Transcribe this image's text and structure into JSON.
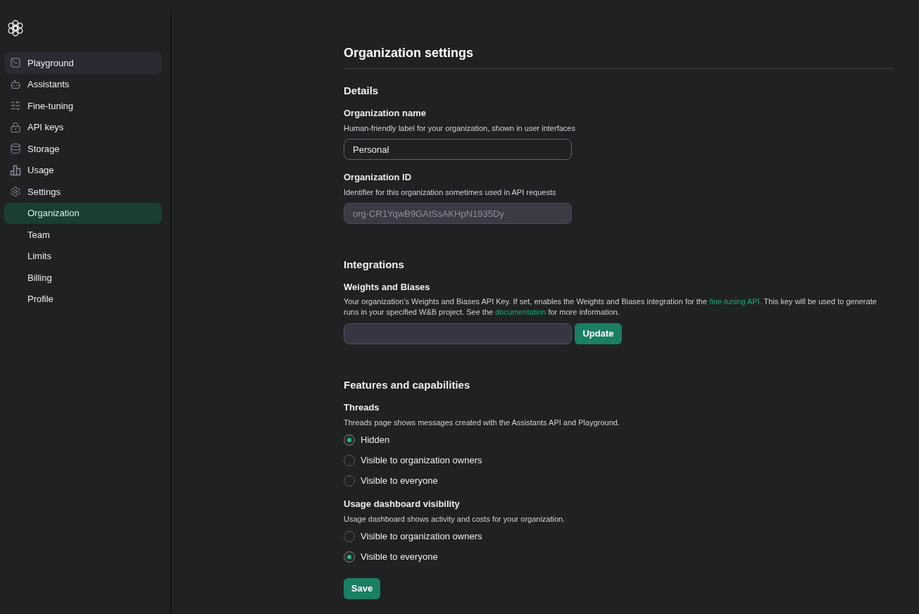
{
  "sidebar": {
    "items": [
      {
        "label": "Playground",
        "selected": false,
        "hovered": true
      },
      {
        "label": "Assistants",
        "selected": false,
        "hovered": false
      },
      {
        "label": "Fine-tuning",
        "selected": false,
        "hovered": false
      },
      {
        "label": "API keys",
        "selected": false,
        "hovered": false
      },
      {
        "label": "Storage",
        "selected": false,
        "hovered": false
      },
      {
        "label": "Usage",
        "selected": false,
        "hovered": false
      },
      {
        "label": "Settings",
        "selected": false,
        "hovered": false,
        "children": [
          {
            "label": "Organization",
            "selected": true,
            "hovered": false
          },
          {
            "label": "Team",
            "selected": false,
            "hovered": false
          },
          {
            "label": "Limits",
            "selected": false,
            "hovered": false
          },
          {
            "label": "Billing",
            "selected": false,
            "hovered": false
          },
          {
            "label": "Profile",
            "selected": false,
            "hovered": false
          }
        ]
      }
    ]
  },
  "page": {
    "title": "Organization settings",
    "sections": [
      {
        "heading": "Details",
        "fields": [
          {
            "kind": "text_input",
            "label": "Organization name",
            "description": "Human-friendly label for your organization, shown in user interfaces",
            "value": "Personal",
            "disabled": false
          },
          {
            "kind": "text_input",
            "label": "Organization ID",
            "description": "Identifier for this organization sometimes used in API requests",
            "value": "org-CR1YqwB9GAtSsAKHpN1935Dy",
            "disabled": true
          }
        ]
      },
      {
        "heading": "Integrations",
        "fields": [
          {
            "kind": "input_with_button",
            "label": "Weights and Biases",
            "description": [
              {
                "text": "Your organization’s Weights and Biases API Key. If set, enables the Weights and Biases integration for the "
              },
              {
                "text": "fine-tuning API.",
                "link": true
              },
              {
                "text": " This key will be used to generate runs in your specified W&B project. See the "
              },
              {
                "text": "documentation",
                "link": true
              },
              {
                "text": " for more information."
              }
            ],
            "button": "Update"
          }
        ]
      },
      {
        "heading": "Features and capabilities",
        "fields": [
          {
            "kind": "radio_group",
            "label": "Threads",
            "description": "Threads page shows messages created with the Assistants API and Playground.",
            "options": [
              {
                "label": "Hidden",
                "selected": true
              },
              {
                "label": "Visible to organization owners",
                "selected": false
              },
              {
                "label": "Visible to everyone",
                "selected": false
              }
            ]
          },
          {
            "kind": "radio_group",
            "label": "Usage dashboard visibility",
            "description": "Usage dashboard shows activity and costs for your organization.",
            "options": [
              {
                "label": "Visible to organization owners",
                "selected": false
              },
              {
                "label": "Visible to everyone",
                "selected": true
              }
            ]
          }
        ]
      }
    ],
    "save_button": "Save"
  }
}
